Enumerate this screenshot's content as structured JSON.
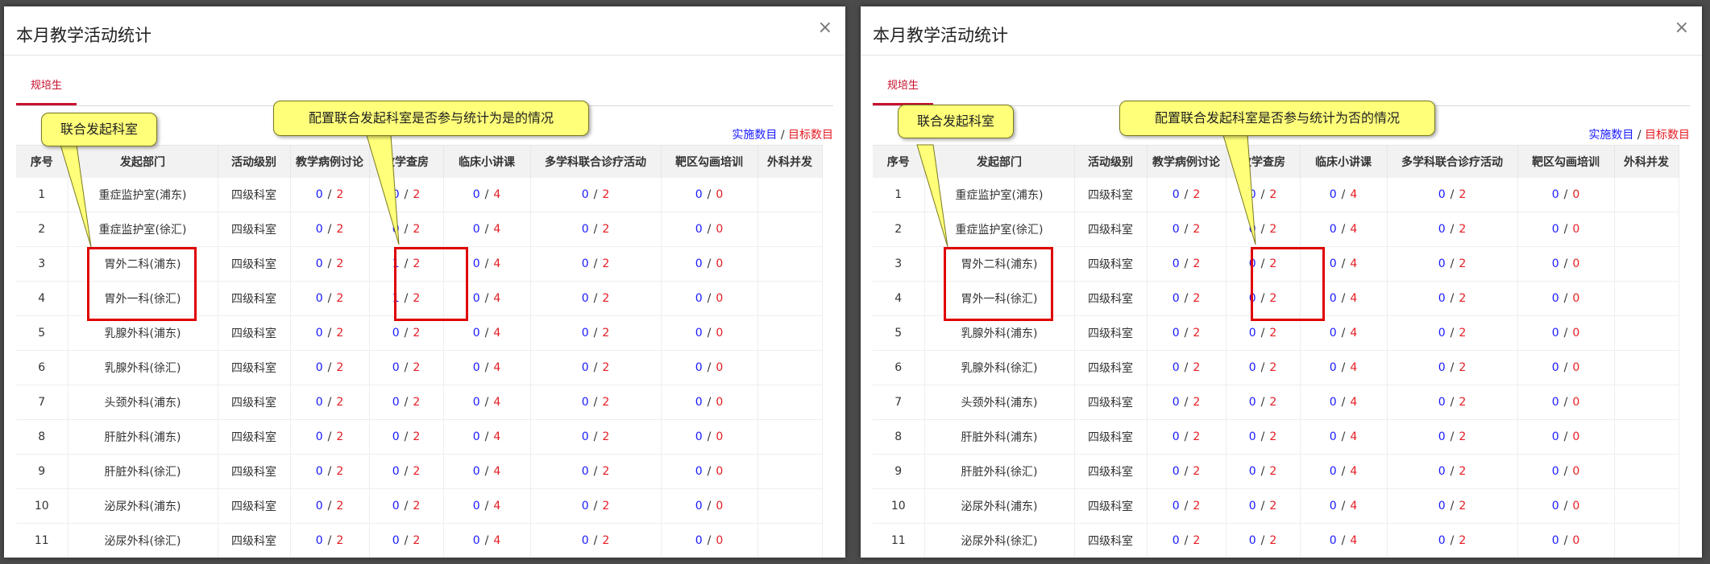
{
  "dialog_title": "本月教学活动统计",
  "close_glyph": "×",
  "tab_label": "规培生",
  "legend": {
    "actual": "实施数目",
    "sep": "/",
    "target": "目标数目"
  },
  "colors": {
    "actual": "#1a1aff",
    "target": "#e51c23",
    "tab_accent": "#c8102e",
    "callout_fill": "#ffff7a",
    "highlight": "#e00000"
  },
  "columns": [
    "序号",
    "发起部门",
    "活动级别",
    "教学病例讨论",
    "教学查房",
    "临床小讲课",
    "多学科联合诊疗活动",
    "靶区勾画培训",
    "外科并发"
  ],
  "left_rows": [
    {
      "no": "1",
      "dept": "重症监护室(浦东)",
      "level": "四级科室",
      "c1": [
        "0",
        "2"
      ],
      "c2": [
        "0",
        "2"
      ],
      "c3": [
        "0",
        "4"
      ],
      "c4": [
        "0",
        "2"
      ],
      "c5": [
        "0",
        "0"
      ]
    },
    {
      "no": "2",
      "dept": "重症监护室(徐汇)",
      "level": "四级科室",
      "c1": [
        "0",
        "2"
      ],
      "c2": [
        "0",
        "2"
      ],
      "c3": [
        "0",
        "4"
      ],
      "c4": [
        "0",
        "2"
      ],
      "c5": [
        "0",
        "0"
      ]
    },
    {
      "no": "3",
      "dept": "胃外二科(浦东)",
      "level": "四级科室",
      "c1": [
        "0",
        "2"
      ],
      "c2": [
        "1",
        "2"
      ],
      "c3": [
        "0",
        "4"
      ],
      "c4": [
        "0",
        "2"
      ],
      "c5": [
        "0",
        "0"
      ]
    },
    {
      "no": "4",
      "dept": "胃外一科(徐汇)",
      "level": "四级科室",
      "c1": [
        "0",
        "2"
      ],
      "c2": [
        "1",
        "2"
      ],
      "c3": [
        "0",
        "4"
      ],
      "c4": [
        "0",
        "2"
      ],
      "c5": [
        "0",
        "0"
      ]
    },
    {
      "no": "5",
      "dept": "乳腺外科(浦东)",
      "level": "四级科室",
      "c1": [
        "0",
        "2"
      ],
      "c2": [
        "0",
        "2"
      ],
      "c3": [
        "0",
        "4"
      ],
      "c4": [
        "0",
        "2"
      ],
      "c5": [
        "0",
        "0"
      ]
    },
    {
      "no": "6",
      "dept": "乳腺外科(徐汇)",
      "level": "四级科室",
      "c1": [
        "0",
        "2"
      ],
      "c2": [
        "0",
        "2"
      ],
      "c3": [
        "0",
        "4"
      ],
      "c4": [
        "0",
        "2"
      ],
      "c5": [
        "0",
        "0"
      ]
    },
    {
      "no": "7",
      "dept": "头颈外科(浦东)",
      "level": "四级科室",
      "c1": [
        "0",
        "2"
      ],
      "c2": [
        "0",
        "2"
      ],
      "c3": [
        "0",
        "4"
      ],
      "c4": [
        "0",
        "2"
      ],
      "c5": [
        "0",
        "0"
      ]
    },
    {
      "no": "8",
      "dept": "肝脏外科(浦东)",
      "level": "四级科室",
      "c1": [
        "0",
        "2"
      ],
      "c2": [
        "0",
        "2"
      ],
      "c3": [
        "0",
        "4"
      ],
      "c4": [
        "0",
        "2"
      ],
      "c5": [
        "0",
        "0"
      ]
    },
    {
      "no": "9",
      "dept": "肝脏外科(徐汇)",
      "level": "四级科室",
      "c1": [
        "0",
        "2"
      ],
      "c2": [
        "0",
        "2"
      ],
      "c3": [
        "0",
        "4"
      ],
      "c4": [
        "0",
        "2"
      ],
      "c5": [
        "0",
        "0"
      ]
    },
    {
      "no": "10",
      "dept": "泌尿外科(浦东)",
      "level": "四级科室",
      "c1": [
        "0",
        "2"
      ],
      "c2": [
        "0",
        "2"
      ],
      "c3": [
        "0",
        "4"
      ],
      "c4": [
        "0",
        "2"
      ],
      "c5": [
        "0",
        "0"
      ]
    },
    {
      "no": "11",
      "dept": "泌尿外科(徐汇)",
      "level": "四级科室",
      "c1": [
        "0",
        "2"
      ],
      "c2": [
        "0",
        "2"
      ],
      "c3": [
        "0",
        "4"
      ],
      "c4": [
        "0",
        "2"
      ],
      "c5": [
        "0",
        "0"
      ]
    }
  ],
  "right_rows": [
    {
      "no": "1",
      "dept": "重症监护室(浦东)",
      "level": "四级科室",
      "c1": [
        "0",
        "2"
      ],
      "c2": [
        "0",
        "2"
      ],
      "c3": [
        "0",
        "4"
      ],
      "c4": [
        "0",
        "2"
      ],
      "c5": [
        "0",
        "0"
      ]
    },
    {
      "no": "2",
      "dept": "重症监护室(徐汇)",
      "level": "四级科室",
      "c1": [
        "0",
        "2"
      ],
      "c2": [
        "0",
        "2"
      ],
      "c3": [
        "0",
        "4"
      ],
      "c4": [
        "0",
        "2"
      ],
      "c5": [
        "0",
        "0"
      ]
    },
    {
      "no": "3",
      "dept": "胃外二科(浦东)",
      "level": "四级科室",
      "c1": [
        "0",
        "2"
      ],
      "c2": [
        "0",
        "2"
      ],
      "c3": [
        "0",
        "4"
      ],
      "c4": [
        "0",
        "2"
      ],
      "c5": [
        "0",
        "0"
      ]
    },
    {
      "no": "4",
      "dept": "胃外一科(徐汇)",
      "level": "四级科室",
      "c1": [
        "0",
        "2"
      ],
      "c2": [
        "0",
        "2"
      ],
      "c3": [
        "0",
        "4"
      ],
      "c4": [
        "0",
        "2"
      ],
      "c5": [
        "0",
        "0"
      ]
    },
    {
      "no": "5",
      "dept": "乳腺外科(浦东)",
      "level": "四级科室",
      "c1": [
        "0",
        "2"
      ],
      "c2": [
        "0",
        "2"
      ],
      "c3": [
        "0",
        "4"
      ],
      "c4": [
        "0",
        "2"
      ],
      "c5": [
        "0",
        "0"
      ]
    },
    {
      "no": "6",
      "dept": "乳腺外科(徐汇)",
      "level": "四级科室",
      "c1": [
        "0",
        "2"
      ],
      "c2": [
        "0",
        "2"
      ],
      "c3": [
        "0",
        "4"
      ],
      "c4": [
        "0",
        "2"
      ],
      "c5": [
        "0",
        "0"
      ]
    },
    {
      "no": "7",
      "dept": "头颈外科(浦东)",
      "level": "四级科室",
      "c1": [
        "0",
        "2"
      ],
      "c2": [
        "0",
        "2"
      ],
      "c3": [
        "0",
        "4"
      ],
      "c4": [
        "0",
        "2"
      ],
      "c5": [
        "0",
        "0"
      ]
    },
    {
      "no": "8",
      "dept": "肝脏外科(浦东)",
      "level": "四级科室",
      "c1": [
        "0",
        "2"
      ],
      "c2": [
        "0",
        "2"
      ],
      "c3": [
        "0",
        "4"
      ],
      "c4": [
        "0",
        "2"
      ],
      "c5": [
        "0",
        "0"
      ]
    },
    {
      "no": "9",
      "dept": "肝脏外科(徐汇)",
      "level": "四级科室",
      "c1": [
        "0",
        "2"
      ],
      "c2": [
        "0",
        "2"
      ],
      "c3": [
        "0",
        "4"
      ],
      "c4": [
        "0",
        "2"
      ],
      "c5": [
        "0",
        "0"
      ]
    },
    {
      "no": "10",
      "dept": "泌尿外科(浦东)",
      "level": "四级科室",
      "c1": [
        "0",
        "2"
      ],
      "c2": [
        "0",
        "2"
      ],
      "c3": [
        "0",
        "4"
      ],
      "c4": [
        "0",
        "2"
      ],
      "c5": [
        "0",
        "0"
      ]
    },
    {
      "no": "11",
      "dept": "泌尿外科(徐汇)",
      "level": "四级科室",
      "c1": [
        "0",
        "2"
      ],
      "c2": [
        "0",
        "2"
      ],
      "c3": [
        "0",
        "4"
      ],
      "c4": [
        "0",
        "2"
      ],
      "c5": [
        "0",
        "0"
      ]
    }
  ],
  "callouts": {
    "left_dept": "联合发起科室",
    "left_main": "配置联合发起科室是否参与统计为是的情况",
    "right_dept": "联合发起科室",
    "right_main": "配置联合发起科室是否参与统计为否的情况"
  }
}
